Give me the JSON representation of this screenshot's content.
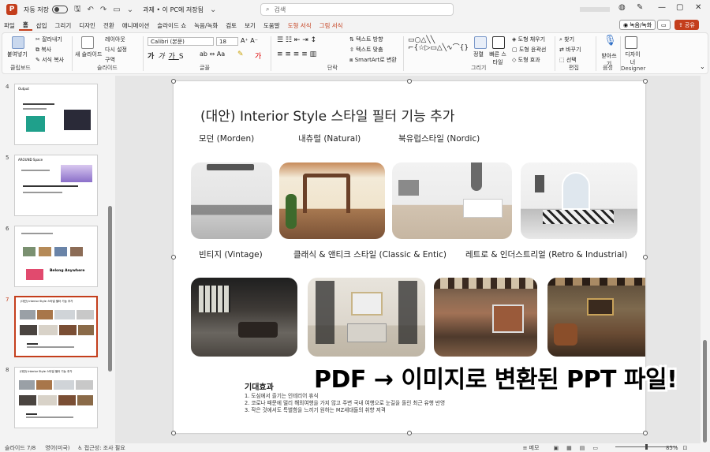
{
  "titlebar": {
    "autosave_label": "자동 저장",
    "toggle_state": "끔",
    "doc_title": "과제 • 이 PC에 저장됨",
    "search_placeholder": "검색"
  },
  "tabs": [
    "파일",
    "홈",
    "삽입",
    "그리기",
    "디자인",
    "전환",
    "애니메이션",
    "슬라이드 쇼",
    "녹음/녹화",
    "검토",
    "보기",
    "도움말",
    "도형 서식",
    "그림 서식"
  ],
  "active_tab": "홈",
  "record_button": "녹음/녹화",
  "share_button": "공유",
  "ribbon": {
    "clipboard": {
      "paste": "붙여넣기",
      "cut": "잘라내기",
      "copy": "복사",
      "format_painter": "서식 복사",
      "label": "클립보드"
    },
    "slides": {
      "new_slide": "새 슬라이드",
      "layout": "레이아웃",
      "reset": "다시 설정",
      "section": "구역",
      "label": "슬라이드"
    },
    "font": {
      "font_name": "Calibri (본문)",
      "font_size": "18",
      "label": "글꼴"
    },
    "paragraph": {
      "text_direction": "텍스트 방향",
      "align_text": "텍스트 맞춤",
      "smartart": "SmartArt로 변환",
      "label": "단락"
    },
    "drawing": {
      "arrange": "정렬",
      "quick_styles": "빠른 스타일",
      "fill": "도형 채우기",
      "outline": "도형 윤곽선",
      "effects": "도형 효과",
      "label": "그리기"
    },
    "editing": {
      "find": "찾기",
      "replace": "바꾸기",
      "select": "선택",
      "label": "편집"
    },
    "voice": {
      "dictate": "받아쓰기",
      "label": "음성"
    },
    "designer": {
      "designer": "디자이너",
      "label": "Designer"
    }
  },
  "thumbnails": [
    {
      "num": "4",
      "title": "Output"
    },
    {
      "num": "5",
      "title": "AROUND Space"
    },
    {
      "num": "6",
      "title": "",
      "badge": "Belong Anywhere"
    },
    {
      "num": "7",
      "title": "(대안) Interior Style 스타일 필터 기능 추가"
    },
    {
      "num": "8",
      "title": "(대안) Interior Style 스타일 필터 기능 추가"
    }
  ],
  "slide": {
    "title": "(대안) Interior Style 스타일 필터 기능 추가",
    "row1_labels": [
      "모던 (Morden)",
      "내츄럴 (Natural)",
      "북유럽스타일 (Nordic)"
    ],
    "row2_labels": [
      "빈티지 (Vintage)",
      "클래식 & 앤티크 스타일 (Classic & Entic)",
      "레트로 & 인더스트리얼 (Retro & Industrial)"
    ],
    "effects_heading": "기대효과",
    "effects": [
      "1. 도심에서 즐기는 인테리어 휴식",
      "2. 코로나 때문에 멀리 해외여행을 가지 않고 주변 국내 여행으로 눈길을 돌린 최근 유행 반영",
      "3. 작은 것에서도 특별함을 느끼기 원하는 MZ세대들의 취향 저격"
    ]
  },
  "overlay_caption": "PDF → 이미지로 변환된 PPT 파일!",
  "status": {
    "slide_info": "슬라이드 7/8",
    "language": "영어(미국)",
    "accessibility": "접근성: 조사 필요",
    "notes": "메모",
    "zoom": "85%"
  },
  "colors": {
    "accent": "#c43e1c",
    "context_tab": "#c43e1c"
  }
}
